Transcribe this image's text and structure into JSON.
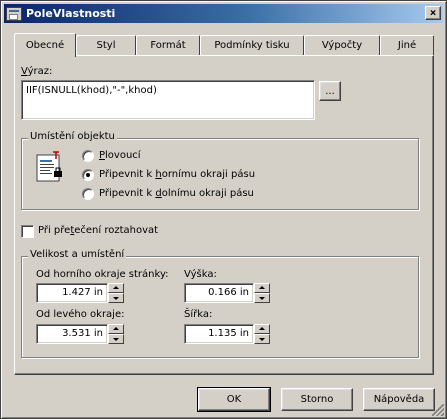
{
  "window": {
    "title": "PoleVlastnosti",
    "close_glyph": "×"
  },
  "tabs": [
    {
      "label": "Obecné",
      "active": true
    },
    {
      "label": "Styl",
      "active": false
    },
    {
      "label": "Formát",
      "active": false
    },
    {
      "label": "Podmínky tisku",
      "active": false
    },
    {
      "label": "Výpočty",
      "active": false
    },
    {
      "label": "Jiné",
      "active": false
    }
  ],
  "expression": {
    "label_hotkey": "V",
    "label_rest": "ýraz:",
    "value": "IIF(ISNULL(khod),\"-\",khod)",
    "browse_label": "..."
  },
  "placement": {
    "title": "Umístění objektu",
    "options": [
      {
        "hotkey": "P",
        "rest": "lovoucí",
        "pre": "",
        "checked": false
      },
      {
        "pre": "Připevnit k ",
        "hotkey": "h",
        "rest": "ornímu okraji pásu",
        "checked": true
      },
      {
        "pre": "Připevnit k ",
        "hotkey": "d",
        "rest": "olnímu okraji pásu",
        "checked": false
      }
    ]
  },
  "overflow": {
    "pre": "Při pře",
    "hotkey": "t",
    "rest": "ečení roztahovat",
    "checked": false
  },
  "size_position": {
    "title": "Velikost a umístění",
    "top_label": "Od horního okraje stránky:",
    "top_value": "1.427 in",
    "height_label": "Výška:",
    "height_value": "0.166 in",
    "left_label": "Od levého okraje:",
    "left_value": "3.531 in",
    "width_label": "Šířka:",
    "width_value": "1.135 in"
  },
  "buttons": {
    "ok": "OK",
    "cancel": "Storno",
    "help": "Nápověda"
  },
  "colors": {
    "face": "#d4d0c8",
    "title_start": "#0a246a",
    "title_end": "#a6caf0"
  }
}
